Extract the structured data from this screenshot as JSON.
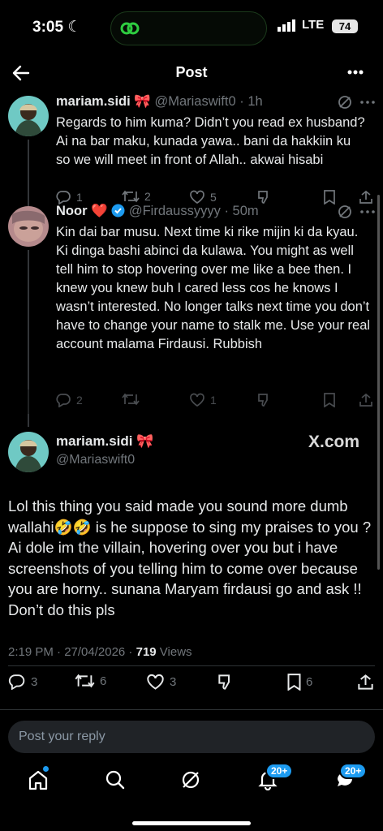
{
  "status_bar": {
    "time": "3:05",
    "network": "LTE",
    "battery": "74"
  },
  "header": {
    "title": "Post"
  },
  "posts": [
    {
      "name": "mariam.sidi",
      "emoji": "🎀",
      "handle": "@Mariaswift0",
      "age": "1h",
      "text": "Regards to him kuma? Didn’t you read ex husband? Ai na bar maku, kunada yawa.. bani da hakkiin ku so we will meet in front of Allah.. akwai hisabi",
      "replies": "1",
      "reposts": "2",
      "likes": "5"
    },
    {
      "name": "Noor",
      "emoji": "❤️",
      "handle": "@Firdaussyyyy",
      "age": "50m",
      "text": "Kin dai bar musu. Next time ki rike mijin ki da kyau. Ki dinga bashi abinci da kulawa.  You might as well tell him to stop hovering over me like a bee then. I knew you knew buh I cared less cos he knows I wasn’t interested. No longer talks next time you don’t have to change your name to stalk me. Use your real account malama Firdausi. Rubbish",
      "replies": "2",
      "reposts": "",
      "likes": "1"
    }
  ],
  "main_post": {
    "name": "mariam.sidi",
    "emoji": "🎀",
    "handle": "@Mariaswift0",
    "watermark": "X.com",
    "text": "Lol this thing you said made you sound more dumb wallahi🤣🤣 is he suppose to sing my praises to you ? Ai dole im the villain,  hovering over you but i have screenshots of you telling him to come over because you are horny.. sunana Maryam firdausi go and ask !! Don’t do this pls",
    "timestamp": "2:19 PM · 27/04/2026 · ",
    "views_count": "719",
    "views_label": " Views",
    "replies": "3",
    "reposts": "6",
    "likes": "3",
    "bookmarks": "6"
  },
  "reply_placeholder": "Post your reply",
  "bottom_nav": {
    "notifications_badge": "20+",
    "messages_badge": "20+"
  },
  "colors": {
    "accent": "#1d9bf0",
    "text": "#e7e9ea",
    "muted": "#71767b",
    "island": "#2ecc40"
  }
}
